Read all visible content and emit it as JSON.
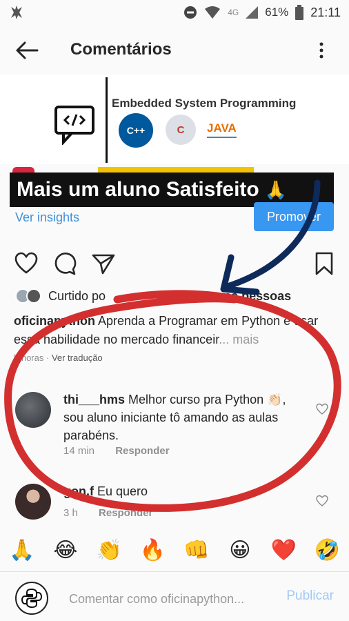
{
  "status_bar": {
    "network": "4G",
    "battery": "61%",
    "time": "21:11"
  },
  "header": {
    "title": "Comentários"
  },
  "banner": {
    "heading": "Embedded System Programming",
    "cpp_label": "C++",
    "c_label": "C",
    "java_label": "JAVA"
  },
  "overlay": {
    "text": "Mais um aluno Satisfeito",
    "emoji": "🙏"
  },
  "post_actions": {
    "insights_label": "Ver insights",
    "promote_label": "Promover"
  },
  "likes": {
    "prefix": "Curtido po",
    "suffix": "ras pessoas"
  },
  "caption": {
    "username": "oficinapython",
    "text": " Aprenda a Programar em Python e usar essa habilidade no mercado financeir",
    "more": "... mais",
    "time": "h horas",
    "translate": "Ver tradução"
  },
  "comments": [
    {
      "username": "thi___hms",
      "text": " Melhor curso pra Python 👏🏻, sou aluno iniciante tô amando as aulas parabéns.",
      "time": "14 min",
      "reply": "Responder"
    },
    {
      "username": "gon.f",
      "text": " Eu quero",
      "time": "3 h",
      "reply": "Responder"
    }
  ],
  "reactions": [
    "🙏",
    "😂",
    "👏",
    "🔥",
    "👊",
    "😀",
    "❤️",
    "🤣"
  ],
  "composer": {
    "placeholder": "Comentar como oficinapython...",
    "publish_label": "Publicar"
  },
  "colors": {
    "accent_blue": "#3897f0",
    "annotation_red": "#d32f2f",
    "arrow_navy": "#0d2a5a"
  }
}
